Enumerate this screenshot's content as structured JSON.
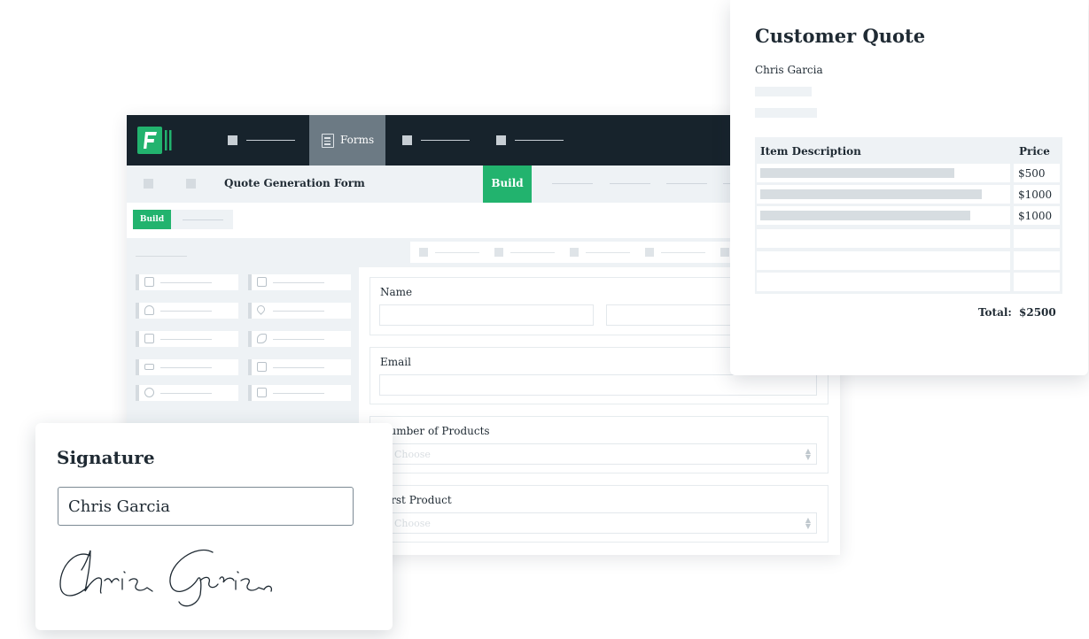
{
  "nav": {
    "forms_label": "Forms"
  },
  "form": {
    "title": "Quote Generation Form",
    "build_tab": "Build",
    "build_pill": "Build"
  },
  "fields": {
    "name_label": "Name",
    "email_label": "Email",
    "num_products_label": "Number of Products",
    "first_product_label": "First Product",
    "select_placeholder": "Choose"
  },
  "quote": {
    "title": "Customer Quote",
    "customer_name": "Chris Garcia",
    "header_description": "Item Description",
    "header_price": "Price",
    "rows": [
      {
        "price": "$500"
      },
      {
        "price": "$1000"
      },
      {
        "price": "$1000"
      },
      {
        "price": ""
      },
      {
        "price": ""
      },
      {
        "price": ""
      }
    ],
    "total_label": "Total:",
    "total_value": "$2500"
  },
  "signature": {
    "title": "Signature",
    "name_value": "Chris Garcia"
  },
  "colors": {
    "accent": "#22b36e",
    "topbar": "#17232c",
    "nav_active": "#6c7a84",
    "panel": "#eef2f5"
  },
  "icons": [
    "form-builder-logo",
    "document-icon",
    "text-icon",
    "paragraph-icon",
    "user-icon",
    "location-icon",
    "email-icon",
    "phone-icon",
    "number-icon",
    "dropdown-icon",
    "radio-icon",
    "checkbox-icon",
    "chevron-updown-icon"
  ]
}
